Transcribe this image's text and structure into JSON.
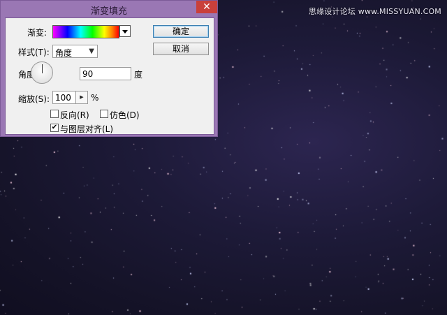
{
  "dialog": {
    "title": "渐变填充",
    "close_glyph": "✕",
    "gradient_label": "渐变:",
    "style_label": "样式(T):",
    "style_value": "角度",
    "angle_label": "角度(A):",
    "angle_value": "90",
    "angle_unit": "度",
    "scale_label": "缩放(S):",
    "scale_value": "100",
    "scale_unit": "%",
    "reverse_label": "反向(R)",
    "reverse_checked": false,
    "dither_label": "仿色(D)",
    "dither_checked": false,
    "align_label": "与图层对齐(L)",
    "align_checked": true,
    "ok_label": "确定",
    "cancel_label": "取消",
    "gradient_colors": [
      "#ff00ff",
      "#0000ff",
      "#00ffff",
      "#00ff00",
      "#ffff00",
      "#ff8000",
      "#ff0000"
    ]
  },
  "watermark": {
    "text": "思缘设计论坛 www.MISSYUAN.COM"
  },
  "colors": {
    "titlebar": "#9a77b4",
    "close": "#c9403b",
    "background": "#1d1a38",
    "stars": [
      "#ffffff",
      "#ffd3e6",
      "#cfd6ff"
    ]
  }
}
